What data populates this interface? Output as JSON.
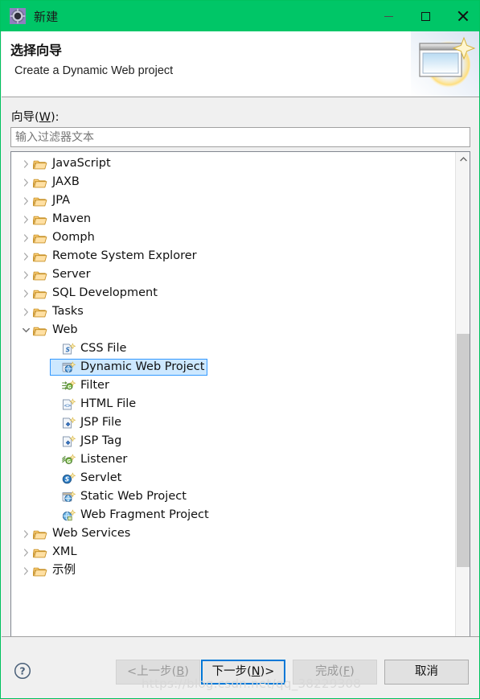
{
  "window": {
    "title": "新建",
    "icon": "wizard-gear-icon",
    "accent_color": "#00c667",
    "controls": {
      "minimize": "minimize-icon",
      "maximize": "maximize-icon",
      "close": "close-icon"
    }
  },
  "header": {
    "title": "选择向导",
    "subtitle": "Create a Dynamic Web project",
    "art": "new-wizard-banner-image"
  },
  "body": {
    "wizard_label_prefix": "向导(",
    "wizard_label_mnemonic": "W",
    "wizard_label_suffix": "):",
    "filter_placeholder": "输入过滤器文本",
    "filter_value": ""
  },
  "tree": {
    "selected": "Dynamic Web Project",
    "selection_bg": "#cde8ff",
    "selection_border": "#3399ff",
    "items": [
      {
        "label": "JavaScript",
        "level": 0,
        "expanded": false,
        "icon": "folder-icon"
      },
      {
        "label": "JAXB",
        "level": 0,
        "expanded": false,
        "icon": "folder-icon"
      },
      {
        "label": "JPA",
        "level": 0,
        "expanded": false,
        "icon": "folder-icon"
      },
      {
        "label": "Maven",
        "level": 0,
        "expanded": false,
        "icon": "folder-icon"
      },
      {
        "label": "Oomph",
        "level": 0,
        "expanded": false,
        "icon": "folder-icon"
      },
      {
        "label": "Remote System Explorer",
        "level": 0,
        "expanded": false,
        "icon": "folder-icon"
      },
      {
        "label": "Server",
        "level": 0,
        "expanded": false,
        "icon": "folder-icon"
      },
      {
        "label": "SQL Development",
        "level": 0,
        "expanded": false,
        "icon": "folder-icon"
      },
      {
        "label": "Tasks",
        "level": 0,
        "expanded": false,
        "icon": "folder-icon"
      },
      {
        "label": "Web",
        "level": 0,
        "expanded": true,
        "icon": "folder-icon"
      },
      {
        "label": "CSS File",
        "level": 1,
        "icon": "css-file-icon"
      },
      {
        "label": "Dynamic Web Project",
        "level": 1,
        "icon": "dynamic-web-project-icon",
        "selected": true
      },
      {
        "label": "Filter",
        "level": 1,
        "icon": "filter-icon"
      },
      {
        "label": "HTML File",
        "level": 1,
        "icon": "html-file-icon"
      },
      {
        "label": "JSP File",
        "level": 1,
        "icon": "jsp-file-icon"
      },
      {
        "label": "JSP Tag",
        "level": 1,
        "icon": "jsp-tag-icon"
      },
      {
        "label": "Listener",
        "level": 1,
        "icon": "listener-icon"
      },
      {
        "label": "Servlet",
        "level": 1,
        "icon": "servlet-icon"
      },
      {
        "label": "Static Web Project",
        "level": 1,
        "icon": "static-web-project-icon"
      },
      {
        "label": "Web Fragment Project",
        "level": 1,
        "icon": "web-fragment-project-icon"
      },
      {
        "label": "Web Services",
        "level": 0,
        "expanded": false,
        "icon": "folder-icon"
      },
      {
        "label": "XML",
        "level": 0,
        "expanded": false,
        "icon": "folder-icon"
      },
      {
        "label": "示例",
        "level": 0,
        "expanded": false,
        "icon": "folder-icon"
      }
    ]
  },
  "footer": {
    "help_icon": "help-question-icon",
    "buttons": {
      "back": {
        "prefix": "<上一步(",
        "mnemonic": "B",
        "suffix": ")",
        "disabled": true
      },
      "next": {
        "prefix": "下一步(",
        "mnemonic": "N",
        "suffix": ")>",
        "focused": true
      },
      "finish": {
        "prefix": "完成(",
        "mnemonic": "F",
        "suffix": ")",
        "disabled": true
      },
      "cancel": {
        "prefix": "取消",
        "mnemonic": "",
        "suffix": ""
      }
    }
  },
  "watermark": "https://blog.csdn.net/qq_38229308"
}
